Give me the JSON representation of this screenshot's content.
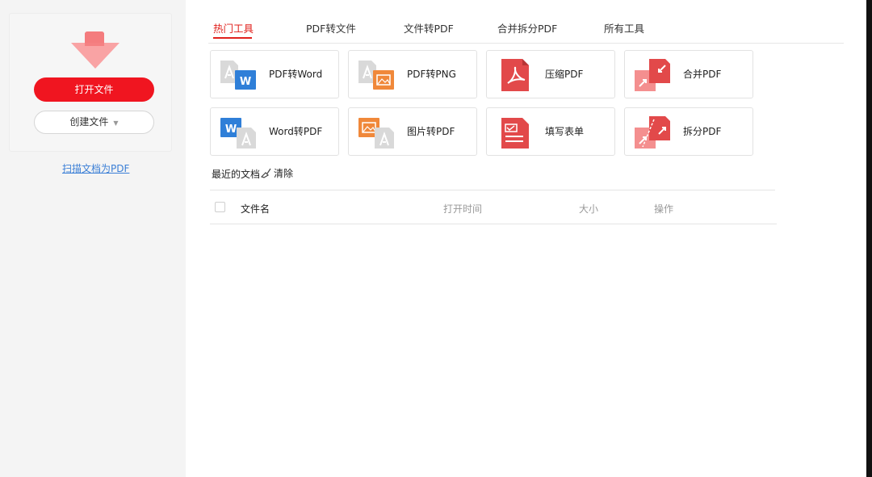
{
  "sidebar": {
    "open_button": "打开文件",
    "create_button": "创建文件",
    "scan_link": "扫描文档为PDF"
  },
  "tabs": [
    "热门工具",
    "PDF转文件",
    "文件转PDF",
    "合并拆分PDF",
    "所有工具"
  ],
  "tools": [
    {
      "label": "PDF转Word",
      "icon": "pdf-to-word-icon"
    },
    {
      "label": "PDF转PNG",
      "icon": "pdf-to-png-icon"
    },
    {
      "label": "压缩PDF",
      "icon": "compress-pdf-icon"
    },
    {
      "label": "合并PDF",
      "icon": "merge-pdf-icon"
    },
    {
      "label": "Word转PDF",
      "icon": "word-to-pdf-icon"
    },
    {
      "label": "图片转PDF",
      "icon": "image-to-pdf-icon"
    },
    {
      "label": "填写表单",
      "icon": "fill-form-icon"
    },
    {
      "label": "拆分PDF",
      "icon": "split-pdf-icon"
    }
  ],
  "recent": {
    "title": "最近的文档",
    "clear": "清除",
    "columns": [
      "文件名",
      "打开时间",
      "大小",
      "操作"
    ]
  },
  "colors": {
    "accent": "#e0201c",
    "button_red": "#f01520",
    "link_blue": "#3b7fd6",
    "pdf_gray": "#d9d9d9",
    "word_blue": "#2f7fd8",
    "image_orange": "#f0883a",
    "pdf_red": "#e2494a"
  }
}
